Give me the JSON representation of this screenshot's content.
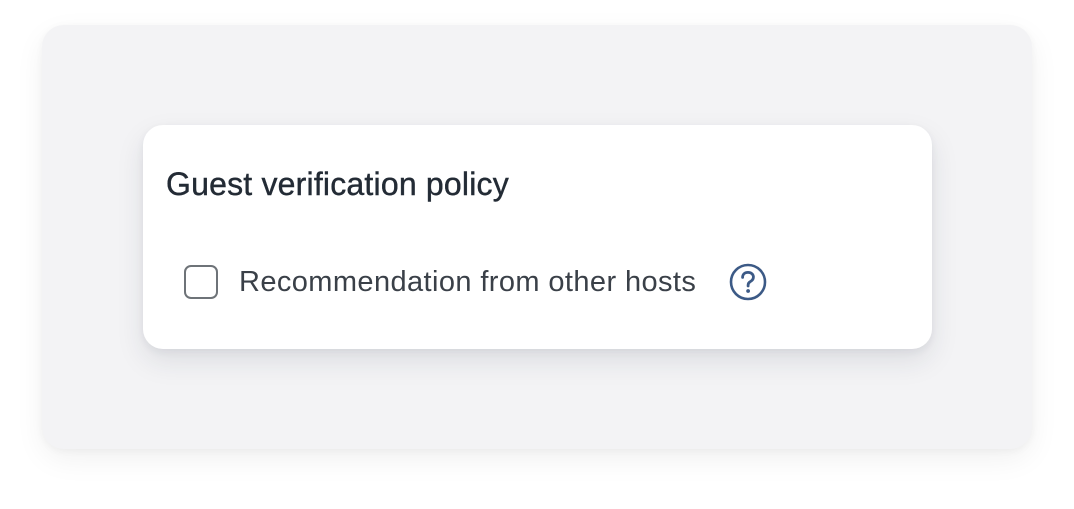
{
  "policy_card": {
    "title": "Guest verification policy",
    "option": {
      "label": "Recommendation from other hosts",
      "checked": false,
      "help_icon": "question-circle-icon"
    }
  },
  "colors": {
    "outer_background": "#f3f3f5",
    "card_background": "#ffffff",
    "title_text": "#232b35",
    "label_text": "#3a4048",
    "checkbox_border": "#6e7378",
    "help_icon": "#3c5a86"
  }
}
